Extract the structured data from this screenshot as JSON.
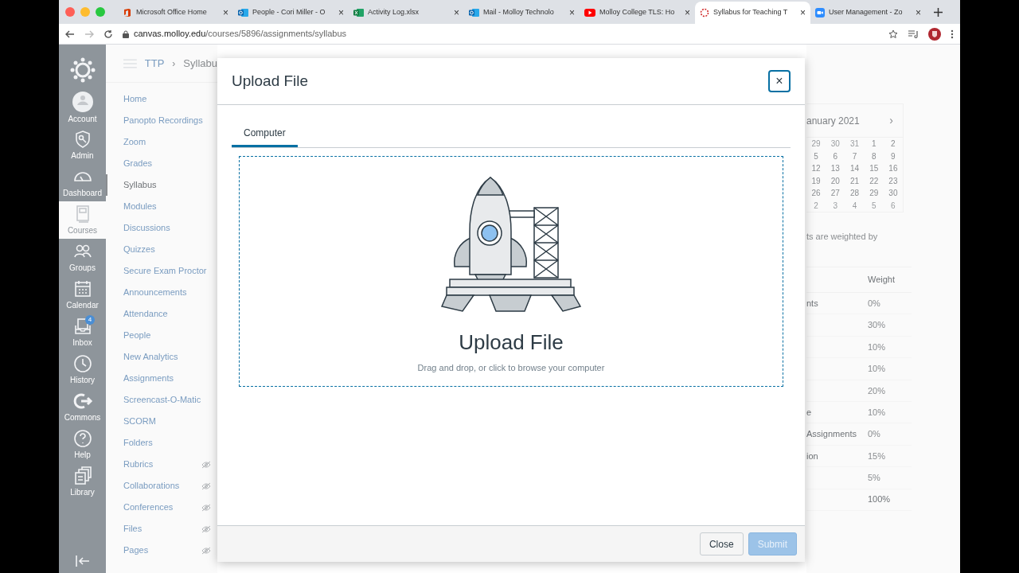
{
  "browser": {
    "tabs": [
      {
        "title": "Microsoft Office Home",
        "kind": "office",
        "selected": false,
        "close": "×"
      },
      {
        "title": "People - Cori Miller - O",
        "kind": "outlook",
        "selected": false,
        "close": "×"
      },
      {
        "title": "Activity Log.xlsx",
        "kind": "excel",
        "selected": false,
        "close": "×"
      },
      {
        "title": "Mail - Molloy Technolo",
        "kind": "outlook",
        "selected": false,
        "close": "×"
      },
      {
        "title": "Molloy College TLS: Ho",
        "kind": "youtube",
        "selected": false,
        "close": "×"
      },
      {
        "title": "Syllabus for Teaching T",
        "kind": "canvas",
        "selected": true,
        "close": "×"
      },
      {
        "title": "User Management - Zo",
        "kind": "zoom",
        "selected": false,
        "close": "×"
      }
    ],
    "url_host": "canvas.molloy.edu",
    "url_path": "/courses/5896/assignments/syllabus"
  },
  "global_nav": [
    {
      "label": "Account",
      "kind": "account",
      "selected": false
    },
    {
      "label": "Admin",
      "kind": "admin",
      "selected": false
    },
    {
      "label": "Dashboard",
      "kind": "dashboard",
      "selected": false
    },
    {
      "label": "Courses",
      "kind": "courses",
      "selected": true
    },
    {
      "label": "Groups",
      "kind": "groups",
      "selected": false
    },
    {
      "label": "Calendar",
      "kind": "calendar",
      "selected": false
    },
    {
      "label": "Inbox",
      "kind": "inbox",
      "selected": false,
      "badge": "4"
    },
    {
      "label": "History",
      "kind": "history",
      "selected": false
    },
    {
      "label": "Commons",
      "kind": "commons",
      "selected": false
    },
    {
      "label": "Help",
      "kind": "help",
      "selected": false
    },
    {
      "label": "Library",
      "kind": "library",
      "selected": false
    }
  ],
  "breadcrumb": {
    "items": [
      "TTP",
      "Syllabu"
    ],
    "separator": "›"
  },
  "course_nav": [
    {
      "label": "Home",
      "selected": false,
      "hidden": false
    },
    {
      "label": "Panopto Recordings",
      "selected": false,
      "hidden": false
    },
    {
      "label": "Zoom",
      "selected": false,
      "hidden": false
    },
    {
      "label": "Grades",
      "selected": false,
      "hidden": false
    },
    {
      "label": "Syllabus",
      "selected": true,
      "hidden": false
    },
    {
      "label": "Modules",
      "selected": false,
      "hidden": false
    },
    {
      "label": "Discussions",
      "selected": false,
      "hidden": false
    },
    {
      "label": "Quizzes",
      "selected": false,
      "hidden": false
    },
    {
      "label": "Secure Exam Proctor",
      "selected": false,
      "hidden": false
    },
    {
      "label": "Announcements",
      "selected": false,
      "hidden": false
    },
    {
      "label": "Attendance",
      "selected": false,
      "hidden": false
    },
    {
      "label": "People",
      "selected": false,
      "hidden": false
    },
    {
      "label": "New Analytics",
      "selected": false,
      "hidden": false
    },
    {
      "label": "Assignments",
      "selected": false,
      "hidden": false
    },
    {
      "label": "Screencast-O-Matic",
      "selected": false,
      "hidden": false
    },
    {
      "label": "SCORM",
      "selected": false,
      "hidden": false
    },
    {
      "label": "Folders",
      "selected": false,
      "hidden": false
    },
    {
      "label": "Rubrics",
      "selected": false,
      "hidden": true
    },
    {
      "label": "Collaborations",
      "selected": false,
      "hidden": true
    },
    {
      "label": "Conferences",
      "selected": false,
      "hidden": true
    },
    {
      "label": "Files",
      "selected": false,
      "hidden": true
    },
    {
      "label": "Pages",
      "selected": false,
      "hidden": true
    }
  ],
  "calendar": {
    "title": "anuary 2021",
    "next": "›",
    "weeks": [
      [
        "29",
        "30",
        "31",
        "1",
        "2"
      ],
      [
        "5",
        "6",
        "7",
        "8",
        "9"
      ],
      [
        "12",
        "13",
        "14",
        "15",
        "16"
      ],
      [
        "19",
        "20",
        "21",
        "22",
        "23"
      ],
      [
        "26",
        "27",
        "28",
        "29",
        "30"
      ],
      [
        "2",
        "3",
        "4",
        "5",
        "6"
      ]
    ]
  },
  "weights_note": "ts are weighted by",
  "weights_table": {
    "header": "Weight",
    "rows": [
      [
        "nts",
        "0%"
      ],
      [
        "",
        "30%"
      ],
      [
        "",
        "10%"
      ],
      [
        "",
        "10%"
      ],
      [
        "",
        "20%"
      ],
      [
        "e",
        "10%"
      ],
      [
        "Assignments",
        "0%"
      ],
      [
        "ion",
        "15%"
      ],
      [
        "",
        "5%"
      ],
      [
        "",
        "100%"
      ]
    ]
  },
  "dialog": {
    "title": "Upload File",
    "close_icon": "×",
    "tabs": [
      {
        "label": "Computer",
        "selected": true
      }
    ],
    "drop_title": "Upload File",
    "drop_hint": "Drag and drop, or click to browse your computer",
    "buttons": [
      {
        "label": "Close",
        "kind": "secondary",
        "disabled": false
      },
      {
        "label": "Submit",
        "kind": "primary",
        "disabled": true
      }
    ]
  }
}
